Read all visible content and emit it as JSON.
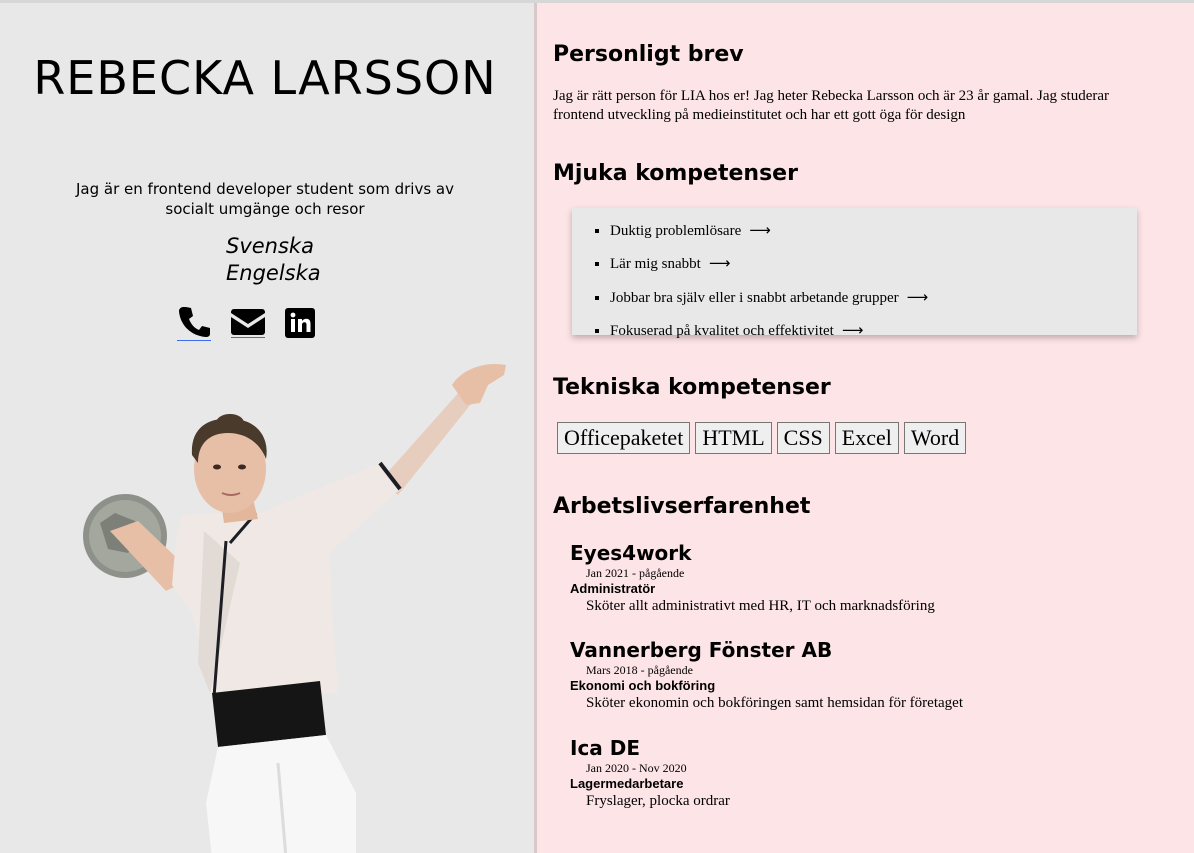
{
  "profile": {
    "name": "REBECKA LARSSON",
    "tagline": "Jag är en frontend developer student som drivs av socialt umgänge och resor",
    "languages": [
      "Svenska",
      "Engelska"
    ],
    "contact_icons": [
      "phone-icon",
      "envelope-icon",
      "linkedin-icon"
    ]
  },
  "letter": {
    "heading": "Personligt brev",
    "text": "Jag är rätt person för LIA hos er! Jag heter Rebecka Larsson och är 23 år gamal. Jag studerar frontend utveckling på medieinstitutet och har ett gott öga för design"
  },
  "soft_skills": {
    "heading": "Mjuka kompetenser",
    "items": [
      "Duktig problemlösare",
      "Lär mig snabbt",
      "Jobbar bra själv eller i snabbt arbetande grupper",
      "Fokuserad på kvalitet och effektivitet"
    ],
    "arrow": "⟶"
  },
  "tech_skills": {
    "heading": "Tekniska kompetenser",
    "items": [
      "Officepaketet",
      "HTML",
      "CSS",
      "Excel",
      "Word"
    ]
  },
  "experience": {
    "heading": "Arbetslivserfarenhet",
    "jobs": [
      {
        "company": "Eyes4work",
        "period": "Jan 2021 - pågående",
        "role": "Administratör",
        "description": "Sköter allt administrativt med HR, IT och marknadsföring"
      },
      {
        "company": "Vannerberg Fönster AB",
        "period": "Mars 2018 - pågående",
        "role": "Ekonomi och bokföring",
        "description": "Sköter ekonomin och bokföringen samt hemsidan för företaget"
      },
      {
        "company": "Ica DE",
        "period": "Jan 2020 - Nov 2020",
        "role": "Lagermedarbetare",
        "description": "Fryslager, plocka ordrar"
      }
    ]
  },
  "colors": {
    "left_bg": "#e8e8e8",
    "right_bg": "#fde4e6",
    "box_bg": "#e8e8e8",
    "link_underline": "#3a6df0"
  }
}
